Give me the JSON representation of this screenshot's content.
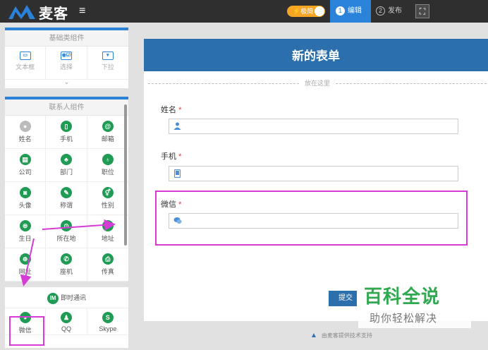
{
  "topbar": {
    "logo_text": "麦客",
    "menu_glyph": "≡",
    "mode_label": "⚡极简",
    "steps": [
      {
        "num": "1",
        "label": "编辑"
      },
      {
        "num": "2",
        "label": "发布"
      }
    ],
    "preview_glyph": "⛶"
  },
  "sidebar": {
    "basic_panel": {
      "title": "基础类组件",
      "items": [
        {
          "label": "文本框",
          "glyph": "▭"
        },
        {
          "label": "选择",
          "glyph": "◉☑"
        },
        {
          "label": "下拉",
          "glyph": "▾"
        }
      ],
      "chevron": "⌄"
    },
    "contact_panel": {
      "title": "联系人组件",
      "items": [
        {
          "label": "姓名",
          "glyph": "●"
        },
        {
          "label": "手机",
          "glyph": "▯"
        },
        {
          "label": "邮箱",
          "glyph": "@"
        },
        {
          "label": "公司",
          "glyph": "▤"
        },
        {
          "label": "部门",
          "glyph": "♣"
        },
        {
          "label": "职位",
          "glyph": "♁"
        },
        {
          "label": "头像",
          "glyph": "◙"
        },
        {
          "label": "称谓",
          "glyph": "✎"
        },
        {
          "label": "性别",
          "glyph": "⚥"
        },
        {
          "label": "生日",
          "glyph": "⊜"
        },
        {
          "label": "所在地",
          "glyph": "⊙"
        },
        {
          "label": "地址",
          "glyph": "↱"
        },
        {
          "label": "网址",
          "glyph": "⊕"
        },
        {
          "label": "座机",
          "glyph": "✆"
        },
        {
          "label": "传真",
          "glyph": "⎙"
        }
      ]
    },
    "im_section": {
      "title": "即时通讯",
      "badge": "IM",
      "items": [
        {
          "label": "微信",
          "glyph": "◕"
        },
        {
          "label": "QQ",
          "glyph": "♟"
        },
        {
          "label": "Skype",
          "glyph": "S"
        }
      ]
    }
  },
  "form": {
    "title": "新的表单",
    "dropzone_text": "放在这里",
    "required_mark": "*",
    "fields": [
      {
        "label": "姓名",
        "icon": "user-icon",
        "glyph": "👤"
      },
      {
        "label": "手机",
        "icon": "phone-icon",
        "glyph": "▯"
      },
      {
        "label": "微信",
        "icon": "wechat-icon",
        "glyph": "◕"
      }
    ],
    "submit_label": "提交",
    "footer_text": "由麦客提供技术支持"
  },
  "watermark": {
    "title": "百科全说",
    "subtitle": "助你轻松解决"
  },
  "colors": {
    "accent": "#2b82d9",
    "header_blue": "#2b6fad",
    "icon_green": "#1f9b54",
    "highlight": "#d63bd6",
    "topbar": "#2f2f2f"
  }
}
